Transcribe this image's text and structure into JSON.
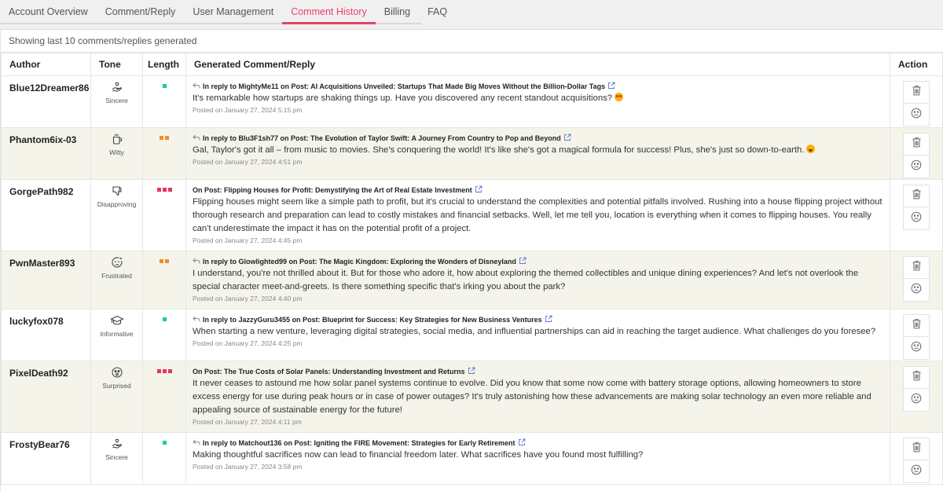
{
  "tabs": [
    {
      "label": "Account Overview",
      "active": false
    },
    {
      "label": "Comment/Reply",
      "active": false
    },
    {
      "label": "User Management",
      "active": false
    },
    {
      "label": "Comment History",
      "active": true
    },
    {
      "label": "Billing",
      "active": false
    },
    {
      "label": "FAQ",
      "active": false
    }
  ],
  "caption": "Showing last 10 comments/replies generated",
  "columns": {
    "author": "Author",
    "tone": "Tone",
    "length": "Length",
    "comment": "Generated Comment/Reply",
    "action": "Action"
  },
  "length_colors": {
    "1": "#1ec8a5",
    "2": "#f58a2a",
    "3": "#e6345e"
  },
  "rows": [
    {
      "author": "Blue12Dreamer86",
      "tone": "Sincere",
      "tone_icon": "heart-hand-icon",
      "length": 1,
      "is_reply": true,
      "context": "In reply to MightyMe11 on Post: AI Acquisitions Unveiled: Startups That Made Big Moves Without the Billion-Dollar Tags",
      "text": "It's remarkable how startups are shaking things up. Have you discovered any recent standout acquisitions?",
      "emoji": "heart-eyes-emoji",
      "date": "Posted on January 27, 2024 5:15 pm"
    },
    {
      "author": "Phantom6ix-03",
      "tone": "Witty",
      "tone_icon": "coffee-mug-icon",
      "length": 2,
      "is_reply": true,
      "context": "In reply to Blu3F1sh77 on Post: The Evolution of Taylor Swift: A Journey From Country to Pop and Beyond",
      "text": "Gal, Taylor's got it all – from music to movies. She's conquering the world! It's like she's got a magical formula for success! Plus, she's just so down-to-earth.",
      "emoji": "grin-emoji",
      "date": "Posted on January 27, 2024 4:51 pm"
    },
    {
      "author": "GorgePath982",
      "tone": "Disapproving",
      "tone_icon": "thumbs-down-icon",
      "length": 3,
      "is_reply": false,
      "context": "On Post: Flipping Houses for Profit: Demystifying the Art of Real Estate Investment",
      "text": "Flipping houses might seem like a simple path to profit, but it's crucial to understand the complexities and potential pitfalls involved. Rushing into a house flipping project without thorough research and preparation can lead to costly mistakes and financial setbacks. Well, let me tell you, location is everything when it comes to flipping houses. You really can't underestimate the impact it has on the potential profit of a project.",
      "emoji": "",
      "date": "Posted on January 27, 2024 4:45 pm"
    },
    {
      "author": "PwnMaster893",
      "tone": "Frustrated",
      "tone_icon": "frustrated-face-icon",
      "length": 2,
      "is_reply": true,
      "context": "In reply to Glowlighted99 on Post: The Magic Kingdom: Exploring the Wonders of Disneyland",
      "text": "I understand, you're not thrilled about it. But for those who adore it, how about exploring the themed collectibles and unique dining experiences? And let's not overlook the special character meet-and-greets. Is there something specific that's irking you about the park?",
      "emoji": "",
      "date": "Posted on January 27, 2024 4:40 pm"
    },
    {
      "author": "luckyfox078",
      "tone": "Informative",
      "tone_icon": "graduation-cap-icon",
      "length": 1,
      "is_reply": true,
      "context": "In reply to JazzyGuru3455 on Post: Blueprint for Success: Key Strategies for New Business Ventures",
      "text": "When starting a new venture, leveraging digital strategies, social media, and influential partnerships can aid in reaching the target audience. What challenges do you foresee?",
      "emoji": "",
      "date": "Posted on January 27, 2024 4:25 pm"
    },
    {
      "author": "PixelDeath92",
      "tone": "Surprised",
      "tone_icon": "surprised-face-icon",
      "length": 3,
      "is_reply": false,
      "context": "On Post: The True Costs of Solar Panels: Understanding Investment and Returns",
      "text": "It never ceases to astound me how solar panel systems continue to evolve. Did you know that some now come with battery storage options, allowing homeowners to store excess energy for use during peak hours or in case of power outages? It's truly astonishing how these advancements are making solar technology an even more reliable and appealing source of sustainable energy for the future!",
      "emoji": "",
      "date": "Posted on January 27, 2024 4:11 pm"
    },
    {
      "author": "FrostyBear76",
      "tone": "Sincere",
      "tone_icon": "heart-hand-icon",
      "length": 1,
      "is_reply": true,
      "context": "In reply to Matchout136 on Post: Igniting the FIRE Movement: Strategies for Early Retirement",
      "text": "Making thoughtful sacrifices now can lead to financial freedom later. What sacrifices have you found most fulfilling?",
      "emoji": "",
      "date": "Posted on January 27, 2024 3:58 pm"
    }
  ],
  "actions": {
    "delete_icon": "trash-icon",
    "dislike_icon": "sad-face-icon"
  }
}
